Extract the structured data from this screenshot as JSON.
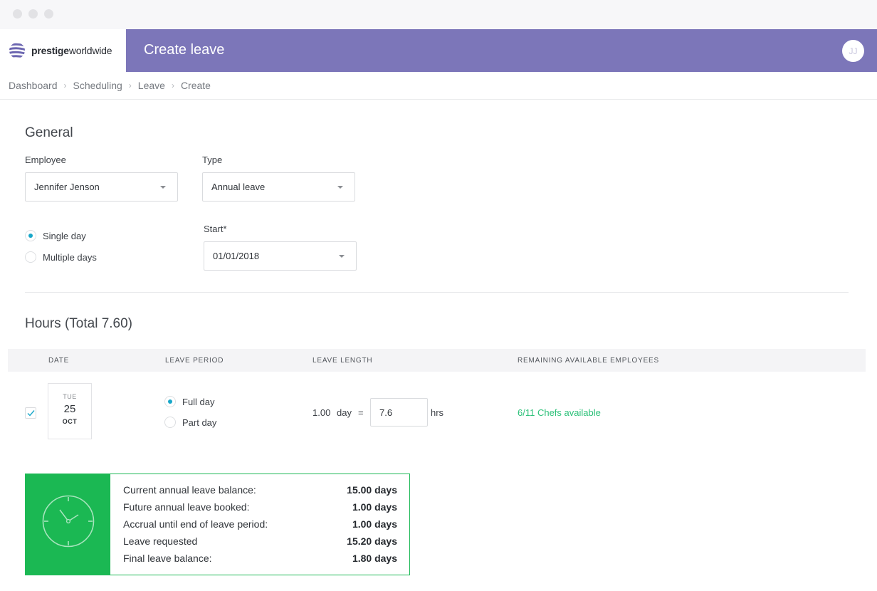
{
  "window": {
    "controls": [
      "close",
      "minimize",
      "maximize"
    ]
  },
  "brand": {
    "name_bold": "prestige",
    "name_regular": "worldwide",
    "logo_icon": "striped-globe-icon"
  },
  "header": {
    "title": "Create leave",
    "avatar_initials": "JJ",
    "color": "#7c76b9"
  },
  "breadcrumb": [
    "Dashboard",
    "Scheduling",
    "Leave",
    "Create"
  ],
  "general": {
    "title": "General",
    "employee_label": "Employee",
    "employee_value": "Jennifer Jenson",
    "type_label": "Type",
    "type_value": "Annual leave",
    "duration_options": [
      {
        "label": "Single day",
        "selected": true
      },
      {
        "label": "Multiple days",
        "selected": false
      }
    ],
    "start_label": "Start*",
    "start_value": "01/01/2018"
  },
  "hours": {
    "title": "Hours (Total 7.60)",
    "columns": [
      "DATE",
      "LEAVE PERIOD",
      "LEAVE LENGTH",
      "REMAINING AVAILABLE EMPLOYEES"
    ],
    "row": {
      "checked": true,
      "date": {
        "dow": "TUE",
        "day": "25",
        "month": "OCT"
      },
      "periods": [
        {
          "label": "Full day",
          "selected": true
        },
        {
          "label": "Part day",
          "selected": false
        }
      ],
      "length_days": "1.00",
      "length_unit": "day",
      "equals": "=",
      "hours_value": "7.6",
      "hours_unit": "hrs",
      "available": "6/11 Chefs available"
    }
  },
  "balance": {
    "icon": "clock-icon",
    "accent": "#1bb853",
    "rows": [
      {
        "label": "Current annual leave balance:",
        "value": "15.00 days"
      },
      {
        "label": "Future annual leave booked:",
        "value": "1.00 days"
      },
      {
        "label": "Accrual until end of leave period:",
        "value": "1.00 days"
      },
      {
        "label": "Leave requested",
        "value": "15.20 days"
      },
      {
        "label": "Final leave balance:",
        "value": "1.80 days"
      }
    ]
  },
  "colors": {
    "radio_selected": "#18a7c9",
    "available_text": "#2ec17a"
  }
}
